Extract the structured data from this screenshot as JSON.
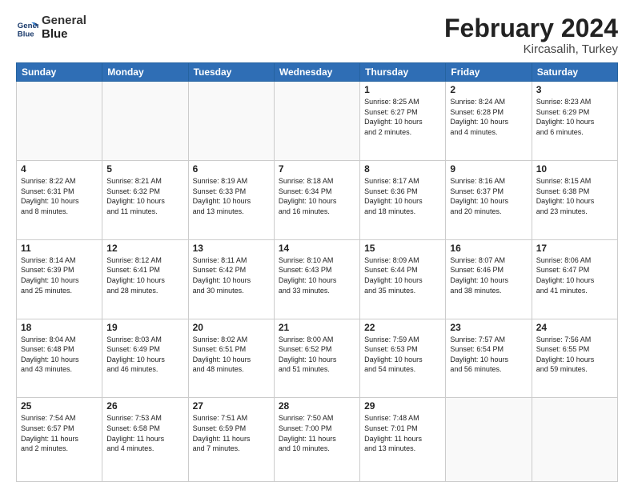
{
  "header": {
    "logo_line1": "General",
    "logo_line2": "Blue",
    "title": "February 2024",
    "subtitle": "Kircasalih, Turkey"
  },
  "weekdays": [
    "Sunday",
    "Monday",
    "Tuesday",
    "Wednesday",
    "Thursday",
    "Friday",
    "Saturday"
  ],
  "weeks": [
    [
      {
        "day": "",
        "detail": ""
      },
      {
        "day": "",
        "detail": ""
      },
      {
        "day": "",
        "detail": ""
      },
      {
        "day": "",
        "detail": ""
      },
      {
        "day": "1",
        "detail": "Sunrise: 8:25 AM\nSunset: 6:27 PM\nDaylight: 10 hours\nand 2 minutes."
      },
      {
        "day": "2",
        "detail": "Sunrise: 8:24 AM\nSunset: 6:28 PM\nDaylight: 10 hours\nand 4 minutes."
      },
      {
        "day": "3",
        "detail": "Sunrise: 8:23 AM\nSunset: 6:29 PM\nDaylight: 10 hours\nand 6 minutes."
      }
    ],
    [
      {
        "day": "4",
        "detail": "Sunrise: 8:22 AM\nSunset: 6:31 PM\nDaylight: 10 hours\nand 8 minutes."
      },
      {
        "day": "5",
        "detail": "Sunrise: 8:21 AM\nSunset: 6:32 PM\nDaylight: 10 hours\nand 11 minutes."
      },
      {
        "day": "6",
        "detail": "Sunrise: 8:19 AM\nSunset: 6:33 PM\nDaylight: 10 hours\nand 13 minutes."
      },
      {
        "day": "7",
        "detail": "Sunrise: 8:18 AM\nSunset: 6:34 PM\nDaylight: 10 hours\nand 16 minutes."
      },
      {
        "day": "8",
        "detail": "Sunrise: 8:17 AM\nSunset: 6:36 PM\nDaylight: 10 hours\nand 18 minutes."
      },
      {
        "day": "9",
        "detail": "Sunrise: 8:16 AM\nSunset: 6:37 PM\nDaylight: 10 hours\nand 20 minutes."
      },
      {
        "day": "10",
        "detail": "Sunrise: 8:15 AM\nSunset: 6:38 PM\nDaylight: 10 hours\nand 23 minutes."
      }
    ],
    [
      {
        "day": "11",
        "detail": "Sunrise: 8:14 AM\nSunset: 6:39 PM\nDaylight: 10 hours\nand 25 minutes."
      },
      {
        "day": "12",
        "detail": "Sunrise: 8:12 AM\nSunset: 6:41 PM\nDaylight: 10 hours\nand 28 minutes."
      },
      {
        "day": "13",
        "detail": "Sunrise: 8:11 AM\nSunset: 6:42 PM\nDaylight: 10 hours\nand 30 minutes."
      },
      {
        "day": "14",
        "detail": "Sunrise: 8:10 AM\nSunset: 6:43 PM\nDaylight: 10 hours\nand 33 minutes."
      },
      {
        "day": "15",
        "detail": "Sunrise: 8:09 AM\nSunset: 6:44 PM\nDaylight: 10 hours\nand 35 minutes."
      },
      {
        "day": "16",
        "detail": "Sunrise: 8:07 AM\nSunset: 6:46 PM\nDaylight: 10 hours\nand 38 minutes."
      },
      {
        "day": "17",
        "detail": "Sunrise: 8:06 AM\nSunset: 6:47 PM\nDaylight: 10 hours\nand 41 minutes."
      }
    ],
    [
      {
        "day": "18",
        "detail": "Sunrise: 8:04 AM\nSunset: 6:48 PM\nDaylight: 10 hours\nand 43 minutes."
      },
      {
        "day": "19",
        "detail": "Sunrise: 8:03 AM\nSunset: 6:49 PM\nDaylight: 10 hours\nand 46 minutes."
      },
      {
        "day": "20",
        "detail": "Sunrise: 8:02 AM\nSunset: 6:51 PM\nDaylight: 10 hours\nand 48 minutes."
      },
      {
        "day": "21",
        "detail": "Sunrise: 8:00 AM\nSunset: 6:52 PM\nDaylight: 10 hours\nand 51 minutes."
      },
      {
        "day": "22",
        "detail": "Sunrise: 7:59 AM\nSunset: 6:53 PM\nDaylight: 10 hours\nand 54 minutes."
      },
      {
        "day": "23",
        "detail": "Sunrise: 7:57 AM\nSunset: 6:54 PM\nDaylight: 10 hours\nand 56 minutes."
      },
      {
        "day": "24",
        "detail": "Sunrise: 7:56 AM\nSunset: 6:55 PM\nDaylight: 10 hours\nand 59 minutes."
      }
    ],
    [
      {
        "day": "25",
        "detail": "Sunrise: 7:54 AM\nSunset: 6:57 PM\nDaylight: 11 hours\nand 2 minutes."
      },
      {
        "day": "26",
        "detail": "Sunrise: 7:53 AM\nSunset: 6:58 PM\nDaylight: 11 hours\nand 4 minutes."
      },
      {
        "day": "27",
        "detail": "Sunrise: 7:51 AM\nSunset: 6:59 PM\nDaylight: 11 hours\nand 7 minutes."
      },
      {
        "day": "28",
        "detail": "Sunrise: 7:50 AM\nSunset: 7:00 PM\nDaylight: 11 hours\nand 10 minutes."
      },
      {
        "day": "29",
        "detail": "Sunrise: 7:48 AM\nSunset: 7:01 PM\nDaylight: 11 hours\nand 13 minutes."
      },
      {
        "day": "",
        "detail": ""
      },
      {
        "day": "",
        "detail": ""
      }
    ]
  ]
}
